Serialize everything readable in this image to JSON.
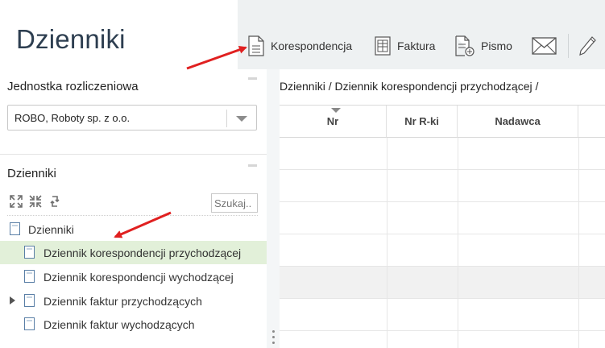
{
  "app": {
    "title": "Dzienniki"
  },
  "toolbar": {
    "items": [
      {
        "label": "Korespondencja",
        "icon": "document-icon"
      },
      {
        "label": "Faktura",
        "icon": "invoice-icon"
      },
      {
        "label": "Pismo",
        "icon": "document-add-icon"
      },
      {
        "label": "",
        "icon": "envelope-icon"
      },
      {
        "label": "",
        "icon": "pencil-icon"
      }
    ]
  },
  "unit_section": {
    "title": "Jednostka rozliczeniowa",
    "selected": "ROBO, Roboty sp. z o.o."
  },
  "journals_section": {
    "title": "Dzienniki",
    "search_placeholder": "Szukaj..",
    "tools": [
      "expand-all-icon",
      "collapse-all-icon",
      "refresh-icon"
    ],
    "tree": [
      {
        "label": "Dzienniki",
        "level": 0,
        "selected": false,
        "expandable": false
      },
      {
        "label": "Dziennik korespondencji przychodzącej",
        "level": 1,
        "selected": true,
        "expandable": false
      },
      {
        "label": "Dziennik korespondencji wychodzącej",
        "level": 1,
        "selected": false,
        "expandable": false
      },
      {
        "label": "Dziennik faktur przychodzących",
        "level": 1,
        "selected": false,
        "expandable": true
      },
      {
        "label": "Dziennik faktur wychodzących",
        "level": 1,
        "selected": false,
        "expandable": false
      }
    ]
  },
  "content": {
    "breadcrumb": "Dzienniki / Dziennik korespondencji przychodzącej /",
    "columns": [
      "Nr",
      "Nr R-ki",
      "Nadawca"
    ]
  },
  "colors": {
    "title": "#2d3e50",
    "selected_row": "#e2f0d9",
    "toolbar_bg": "#eef1f2",
    "arrow": "#e02020"
  }
}
